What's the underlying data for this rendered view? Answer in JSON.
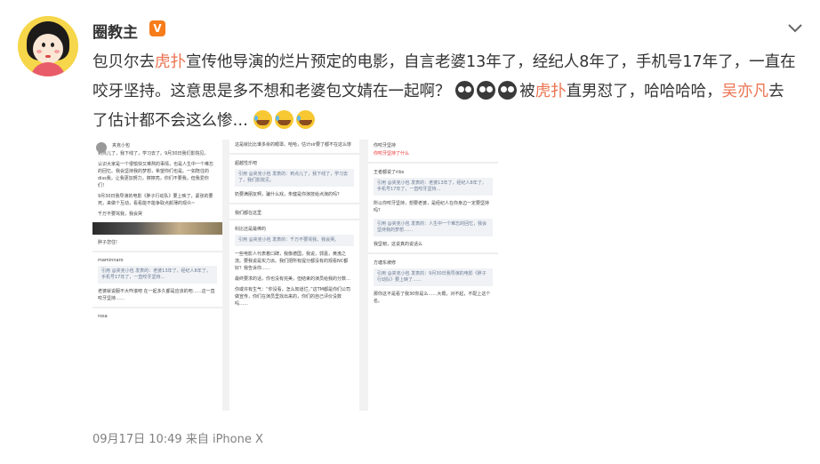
{
  "user": {
    "name": "圈教主",
    "vip": "V"
  },
  "post": {
    "seg1": "包贝尔去",
    "link1": "虎扑",
    "seg2": "宣传他导演的烂片预定的电影，自言老婆13年了，经纪人8年了，手机号17年了，一直在咬牙坚持。这意思是多不想和老婆包文婧在一起啊？",
    "seg3": "被",
    "link2": "虎扑",
    "seg4": "直男怼了，哈哈哈哈，",
    "link3": "吴亦凡",
    "seg5": "去了估计都不会这么惨…",
    "emoji_cry": "cry-face-emoji",
    "emoji_laugh": "laugh-tears-emoji"
  },
  "shots": {
    "s1": {
      "author": "夹克小包",
      "p1": "到点儿了，我下线了，学习去了。9月30日我们影院见。",
      "p2": "认识大家是一个很愉快又难熬的事情，也是人生中一个难忘的回忆。我会坚持我的梦想，希望你们也是。一如既往的diss我，让我更加努力，擦擦亮，你们不要我，但我爱你们！",
      "p3": "9月30日我导演的电影《胖子行动队》要上映了，紧张的要死，来做个互动，看看能不能争取点颜薄的观众~",
      "p4": "千万不要骂我，我会哭",
      "p5": "胖子您住!",
      "c1": "maminnaro",
      "quote": "引用 @夹克小包 发表的：老婆13年了，经纪人8年了，手机号17年了，一直咬牙坚持…",
      "p6": "老婆就说服不大咋滚吧 在一起多久都是应该的吧……这一直咬牙坚持……",
      "c2": "rosa"
    },
    "s2": {
      "p1": "这是就比比谁多余的眼罩。哈哈，估计sir要了都不在这么惨",
      "c1": "超越性乐吧",
      "quote1": "引用 @夹克小包 发表的：到点儿了，我下线了，学习去了，我们影院见。",
      "p2": "奶要满朋友啊，骗什么戏，朱健是你演技给点演的吗？",
      "c2": "我们都在这里",
      "c3": "科比还是最棒的",
      "quote2": "引用 @夹克小包 发表的：千万不要骂我，我会哭。",
      "p3": "一些电影人代表着口碑，我像德国，我说，郭嘉，黄渤之流。要我说是实力派。我们把所有提分都没有的观看NC都好？我告诉你……",
      "p4": "最终要求的话，你也没有完美，但结束的演员给我的分数…",
      "p5": "你或许有生气：“你没看，怎么知道烂。”这TM都是你们公司做宣传，你们在演员里找出来的，你们的自己评价没数吗……"
    },
    "s3": {
      "c1": "你咬牙坚持",
      "p1": "你咬牙坚持了什么",
      "c2": "王者都说了ribs",
      "quote1": "引用 @夹克小包 发表的：老婆13年了，经纪人8年了，手机号17年了，一直咬牙坚持…",
      "p2": "所以你咬牙坚持，想要老婆，是经纪人在你身边一定要坚持吗？",
      "quote2": "引用 @夹克小包 发表的：人生中一个难忘的回忆，我会坚持我的梦想……",
      "p3": "我坚韧，这说真的说话么",
      "c3": "方塘东坡修",
      "quote3": "引用 @夹克小包 发表的：9月30日我导演的电影《胖子行动队》要上映了……",
      "p4": "那你这不是看了我30你是么……大概，对不起，不配上这个名。"
    }
  },
  "meta": {
    "date": "09月17日 10:49",
    "source": "来自 iPhone X"
  }
}
